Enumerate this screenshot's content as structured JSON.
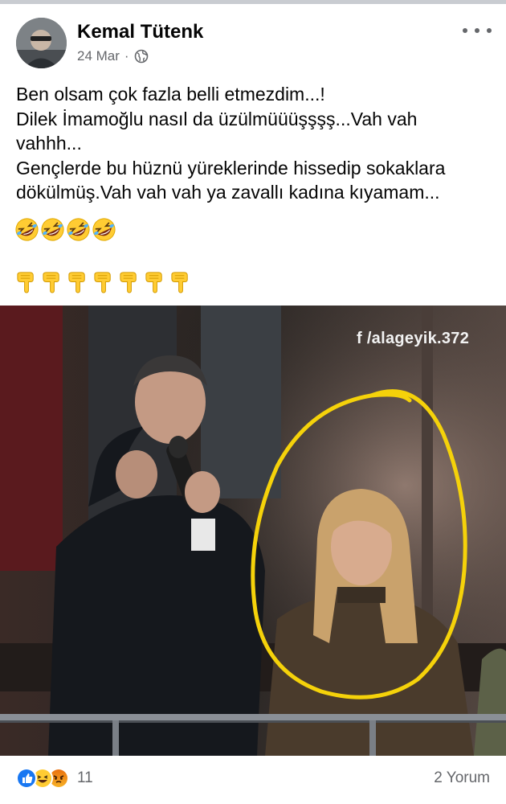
{
  "post": {
    "author": "Kemal Tütenk",
    "date": "24 Mar",
    "separator": "·",
    "privacy_icon": "globe-icon",
    "text_lines": [
      "Ben olsam çok fazla belli etmezdim...!",
      "Dilek İmamoğlu nasıl da üzülmüüüşşşş...Vah vah",
      "vahhh...",
      "Gençlerde bu hüznü yüreklerinde hissedip sokaklara",
      "dökülmüş.Vah vah vah ya zavallı kadına kıyamam..."
    ],
    "laugh_emojis": [
      "rolling-on-floor-laughing",
      "rolling-on-floor-laughing",
      "rolling-on-floor-laughing",
      "rolling-on-floor-laughing"
    ],
    "hand_emojis": [
      "backhand-index-pointing-down",
      "backhand-index-pointing-down",
      "backhand-index-pointing-down",
      "backhand-index-pointing-down",
      "backhand-index-pointing-down",
      "backhand-index-pointing-down",
      "backhand-index-pointing-down"
    ]
  },
  "photo": {
    "watermark": "f /alageyik.372"
  },
  "footer": {
    "reaction_icons": [
      "like-icon",
      "haha-icon",
      "angry-icon"
    ],
    "reaction_count": "11",
    "comments_label": "2 Yorum"
  },
  "colors": {
    "like": "#1877f2",
    "emoji_yellow": "#ffcc33",
    "highlight_circle": "#f5d20a",
    "secondary_text": "#65676b"
  }
}
